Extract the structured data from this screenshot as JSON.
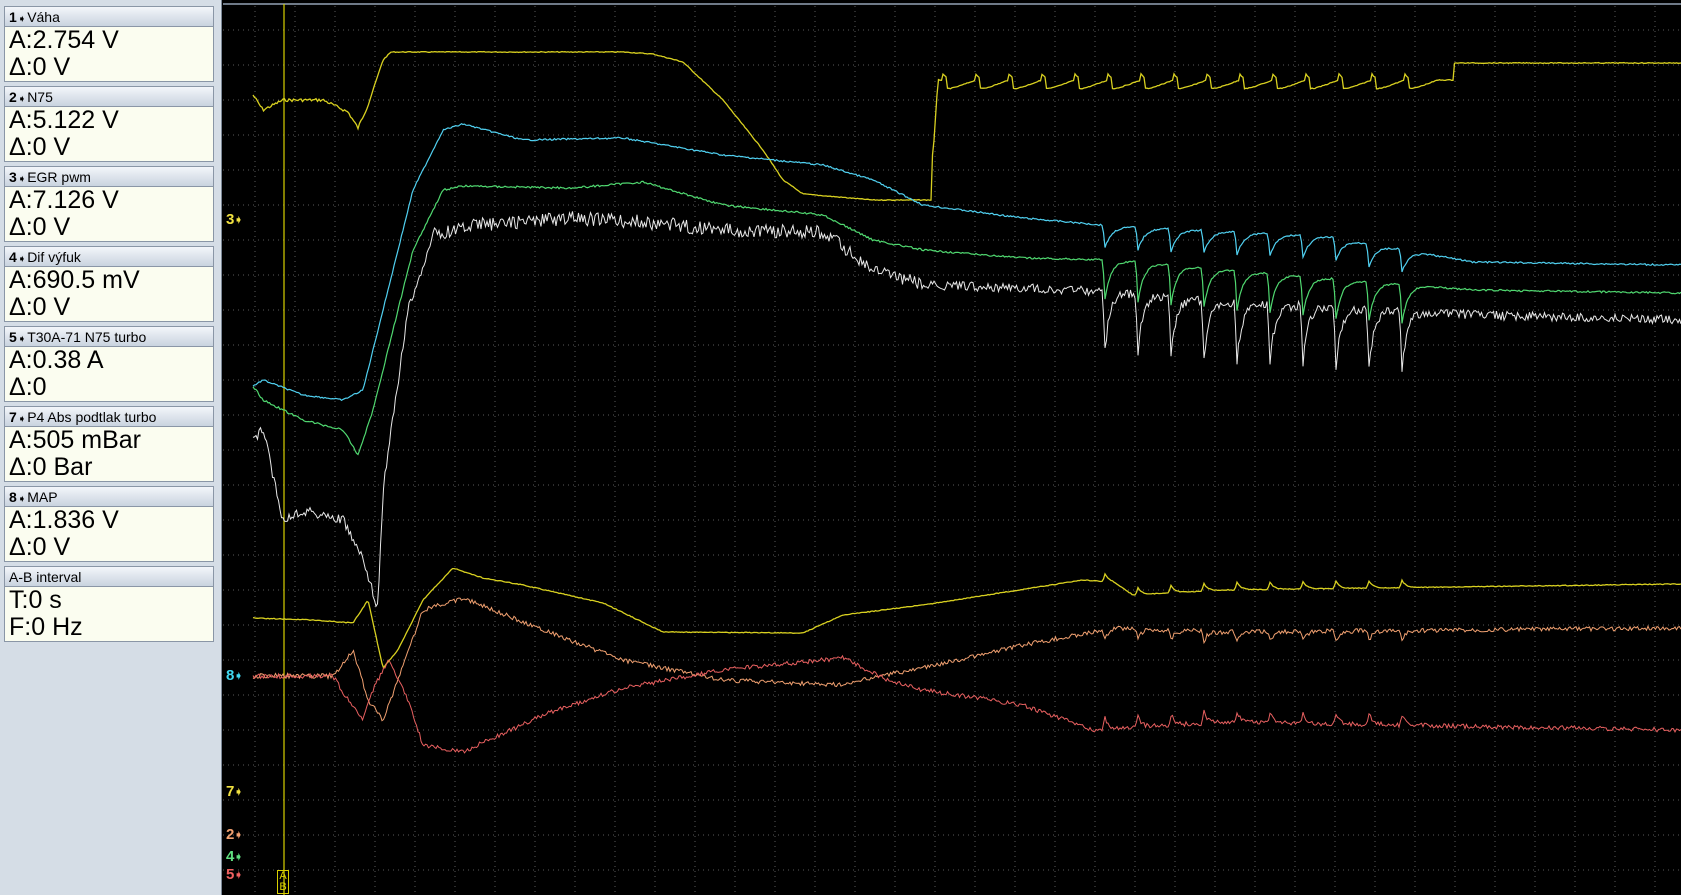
{
  "channels": [
    {
      "id": "1",
      "name": "Váha",
      "a": "A:2.754 V",
      "d": "Δ:0 V"
    },
    {
      "id": "2",
      "name": "N75",
      "a": "A:5.122 V",
      "d": "Δ:0 V"
    },
    {
      "id": "3",
      "name": "EGR pwm",
      "a": "A:7.126 V",
      "d": "Δ:0 V"
    },
    {
      "id": "4",
      "name": "Dif výfuk",
      "a": "A:690.5 mV",
      "d": "Δ:0 V"
    },
    {
      "id": "5",
      "name": "T30A-71 N75 turbo",
      "a": "A:0.38 A",
      "d": "Δ:0"
    },
    {
      "id": "7",
      "name": "P4 Abs podtlak turbo",
      "a": "A:505 mBar",
      "d": "Δ:0 Bar"
    },
    {
      "id": "8",
      "name": "MAP",
      "a": "A:1.836 V",
      "d": "Δ:0 V"
    }
  ],
  "interval": {
    "title": "A-B interval",
    "t": "T:0 s",
    "f": "F:0 Hz"
  },
  "markers": [
    {
      "label": "3",
      "color": "#f0e040"
    },
    {
      "label": "8",
      "color": "#40d8f0"
    },
    {
      "label": "7",
      "color": "#f0e040"
    },
    {
      "label": "2",
      "color": "#f0a070"
    },
    {
      "label": "4",
      "color": "#60e080"
    },
    {
      "label": "5",
      "color": "#f06060"
    }
  ],
  "cursor": {
    "a": "A",
    "b": "B"
  },
  "colors": {
    "background": "#000000",
    "grid": "#5a5a5a",
    "trace_yellow": "#d8d020",
    "trace_cyan": "#50d0f0",
    "trace_green": "#50d870",
    "trace_white": "#e8e8e8",
    "trace_orange": "#f0a070",
    "trace_red": "#e86060",
    "cursor": "#d8d000"
  }
}
